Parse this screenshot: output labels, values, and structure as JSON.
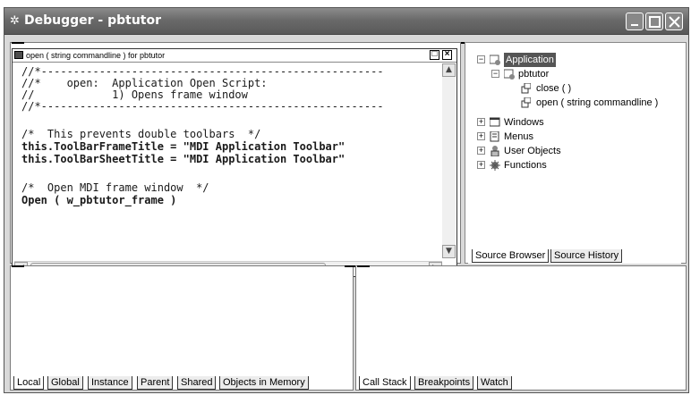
{
  "window": {
    "title": "Debugger - pbtutor",
    "icon": "bug-icon"
  },
  "code_window": {
    "title": "open ( string commandline ) for pbtutor",
    "lines": [
      {
        "text": "//*-----------------------------------------------------",
        "bold": false
      },
      {
        "text": "//*    open:  Application Open Script:",
        "bold": false
      },
      {
        "text": "//            1) Opens frame window",
        "bold": false
      },
      {
        "text": "//*-----------------------------------------------------",
        "bold": false
      },
      {
        "text": "",
        "bold": false
      },
      {
        "text": "/*  This prevents double toolbars  */",
        "bold": false
      },
      {
        "text": "this.ToolBarFrameTitle = \"MDI Application Toolbar\"",
        "bold": true
      },
      {
        "text": "this.ToolBarSheetTitle = \"MDI Application Toolbar\"",
        "bold": true
      },
      {
        "text": "",
        "bold": false
      },
      {
        "text": "/*  Open MDI frame window  */",
        "bold": false
      },
      {
        "text": "Open ( w_pbtutor_frame )",
        "bold": true
      }
    ],
    "restore_label": "□",
    "close_label": "×"
  },
  "tree": {
    "application": "Application",
    "pbtutor": "pbtutor",
    "close_fn": "close ( )",
    "open_fn": "open ( string commandline )",
    "windows": "Windows",
    "menus": "Menus",
    "user_objects": "User Objects",
    "functions": "Functions"
  },
  "tree_tabs": [
    "Source Browser",
    "Source History"
  ],
  "variables_tabs": [
    "Local",
    "Global",
    "Instance",
    "Parent",
    "Shared",
    "Objects in Memory"
  ],
  "stack_tabs": [
    "Call Stack",
    "Breakpoints",
    "Watch"
  ]
}
